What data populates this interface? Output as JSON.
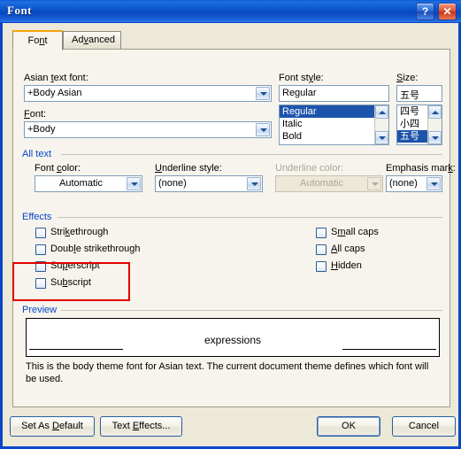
{
  "window": {
    "title": "Font",
    "help_button": "?",
    "close_button": "✕"
  },
  "tabs": [
    {
      "label_pre": "Fo",
      "label_acc": "n",
      "label_post": "t",
      "label": "Font",
      "active": true
    },
    {
      "label_pre": "Ad",
      "label_acc": "v",
      "label_post": "anced",
      "label": "Advanced",
      "active": false
    }
  ],
  "fields": {
    "asian_text_font": {
      "label_pre": "Asian ",
      "label_acc": "t",
      "label_post": "ext font:",
      "value": "+Body Asian",
      "selected": true
    },
    "latin_font": {
      "label_pre": "",
      "label_acc": "F",
      "label_post": "ont:",
      "value": "+Body"
    },
    "font_style": {
      "label_pre": "Font st",
      "label_acc": "y",
      "label_post": "le:",
      "value": "Regular",
      "options": [
        "Regular",
        "Italic",
        "Bold"
      ],
      "selected_index": 0
    },
    "size": {
      "label_pre": "",
      "label_acc": "S",
      "label_post": "ize:",
      "value": "五号",
      "options": [
        "四号",
        "小四",
        "五号"
      ],
      "selected_index": 2
    }
  },
  "all_text": {
    "group_label": "All text",
    "font_color": {
      "label_pre": "Font ",
      "label_acc": "c",
      "label_post": "olor:",
      "value": "Automatic",
      "disabled": false
    },
    "underline_style": {
      "label_pre": "",
      "label_acc": "U",
      "label_post": "nderline style:",
      "value": "(none)",
      "disabled": false
    },
    "underline_color": {
      "label_pre": "Underline color:",
      "label_acc": "",
      "label_post": "",
      "value": "Automatic",
      "disabled": true
    },
    "emphasis_mark": {
      "label_pre": "Emphasis mar",
      "label_acc": "k",
      "label_post": ":",
      "value": "(none)",
      "disabled": false
    }
  },
  "effects": {
    "group_label": "Effects",
    "left_column": [
      {
        "pre": "Stri",
        "acc": "k",
        "post": "ethrough",
        "label": "Strikethrough",
        "checked": false
      },
      {
        "pre": "Doub",
        "acc": "l",
        "post": "e strikethrough",
        "label": "Double strikethrough",
        "checked": false
      },
      {
        "pre": "Su",
        "acc": "p",
        "post": "erscript",
        "label": "Superscript",
        "checked": false
      },
      {
        "pre": "Su",
        "acc": "b",
        "post": "script",
        "label": "Subscript",
        "checked": false
      }
    ],
    "right_column": [
      {
        "pre": "S",
        "acc": "m",
        "post": "all caps",
        "label": "Small caps",
        "checked": false
      },
      {
        "pre": "",
        "acc": "A",
        "post": "ll caps",
        "label": "All caps",
        "checked": false
      },
      {
        "pre": "",
        "acc": "H",
        "post": "idden",
        "label": "Hidden",
        "checked": false
      }
    ]
  },
  "preview": {
    "group_label": "Preview",
    "sample_text": "expressions",
    "description": "This is the body theme font for Asian text. The current document theme defines which font will be used."
  },
  "buttons": {
    "set_as_default": {
      "pre": "Set As ",
      "acc": "D",
      "post": "efault",
      "label": "Set As Default"
    },
    "text_effects": {
      "pre": "Text ",
      "acc": "E",
      "post": "ffects...",
      "label": "Text Effects..."
    },
    "ok": "OK",
    "cancel": "Cancel"
  },
  "annotation": {
    "color": "#e00000",
    "targets": "Superscript and Subscript"
  },
  "colors": {
    "titlebar_blue": "#0b57d6",
    "group_label_blue": "#0646c8",
    "selection_blue": "#1d54ab",
    "dialog_face": "#ece9d8",
    "panel_face": "#f6f4ec",
    "annotation_red": "#e00000"
  }
}
